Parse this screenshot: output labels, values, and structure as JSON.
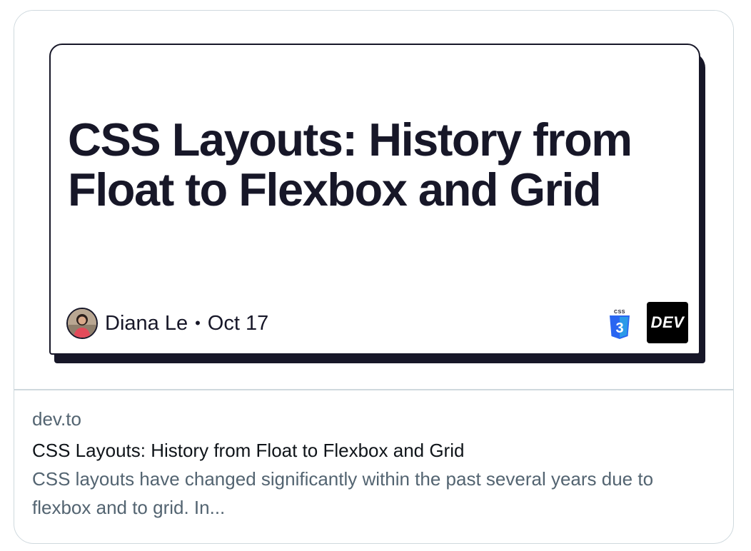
{
  "media": {
    "cover_title": "CSS Layouts: History from Float to Flexbox and Grid",
    "author": "Diana Le",
    "separator": "•",
    "date": "Oct 17",
    "dev_logo_text": "DEV",
    "css_logo_text": "CSS",
    "css_logo_number": "3"
  },
  "link": {
    "domain": "dev.to",
    "title": "CSS Layouts: History from Float to Flexbox and Grid",
    "description": "CSS layouts have changed significantly within the past several years due to flexbox and to grid. In..."
  },
  "colors": {
    "border": "#cfd9de",
    "dark_ink": "#171728",
    "secondary_text": "#536471",
    "primary_text": "#0f1419",
    "css3_blue": "#2965f1"
  }
}
